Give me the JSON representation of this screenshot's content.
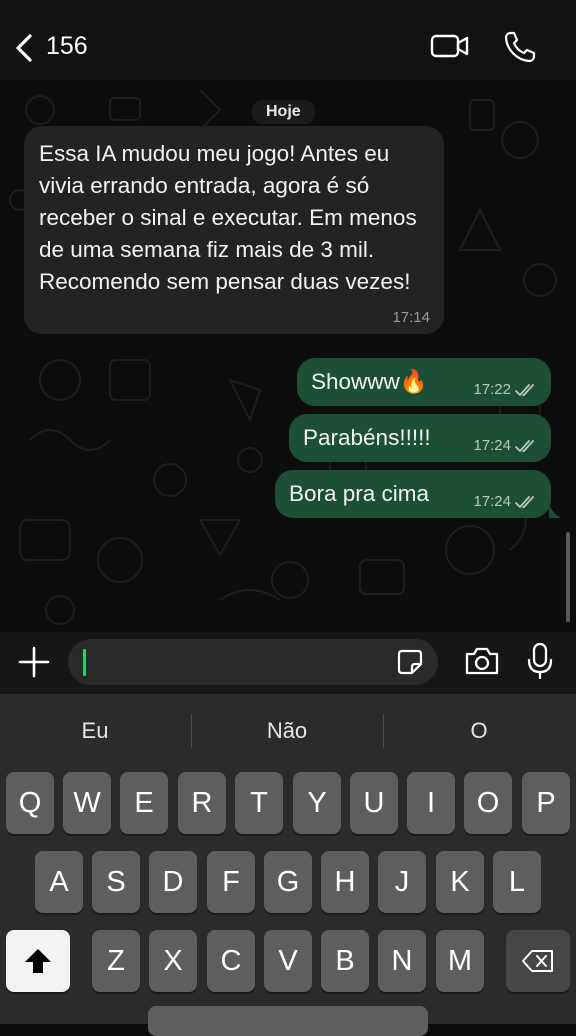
{
  "header": {
    "contact": "156"
  },
  "chat": {
    "day": "Hoje",
    "incoming": {
      "text": "Essa IA mudou meu jogo! Antes eu vivia errando entrada, agora é só receber o sinal e executar. Em menos de uma semana fiz mais de 3 mil. Recomendo sem pensar duas vezes!",
      "time": "17:14"
    },
    "outgoing": [
      {
        "text": "Showww🔥",
        "time": "17:22"
      },
      {
        "text": "Parabéns!!!!!",
        "time": "17:24"
      },
      {
        "text": "Bora pra cima",
        "time": "17:24"
      }
    ]
  },
  "input": {
    "value": ""
  },
  "keyboard": {
    "suggestions": [
      "Eu",
      "Não",
      "O"
    ],
    "row1": [
      "Q",
      "W",
      "E",
      "R",
      "T",
      "Y",
      "U",
      "I",
      "O",
      "P"
    ],
    "row2": [
      "A",
      "S",
      "D",
      "F",
      "G",
      "H",
      "J",
      "K",
      "L"
    ],
    "row3": [
      "Z",
      "X",
      "C",
      "V",
      "B",
      "N",
      "M"
    ]
  },
  "colors": {
    "outgoing_bubble": "#1c4f35",
    "incoming_bubble": "#232323",
    "accent": "#25d366"
  }
}
